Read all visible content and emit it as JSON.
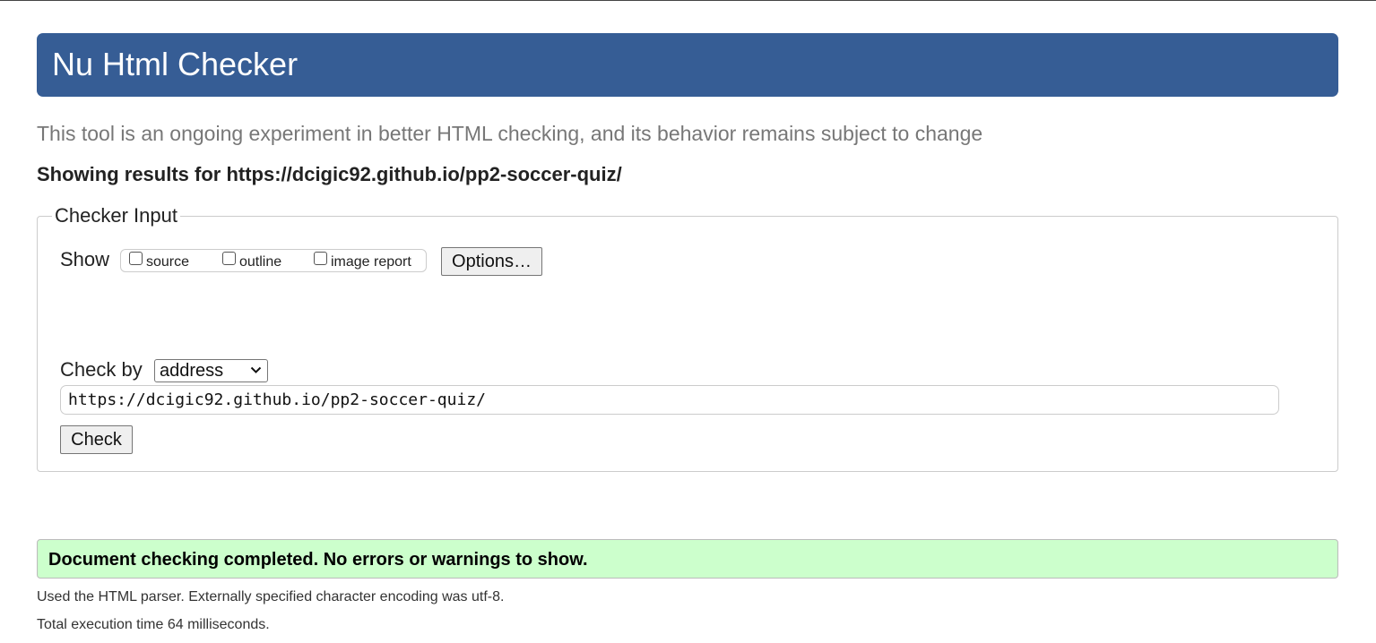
{
  "header": {
    "title": "Nu Html Checker"
  },
  "subtitle": "This tool is an ongoing experiment in better HTML checking, and its behavior remains subject to change",
  "showing_results": "Showing results for https://dcigic92.github.io/pp2-soccer-quiz/",
  "checker_input": {
    "legend": "Checker Input",
    "show_label": "Show",
    "show_options": [
      {
        "label": "source",
        "checked": false
      },
      {
        "label": "outline",
        "checked": false
      },
      {
        "label": "image report",
        "checked": false
      }
    ],
    "options_button": "Options…",
    "check_by_label": "Check by",
    "check_by_selected": "address",
    "url_value": "https://dcigic92.github.io/pp2-soccer-quiz/",
    "check_button": "Check"
  },
  "result": {
    "message": "Document checking completed. No errors or warnings to show.",
    "status_color": "#ccffcc"
  },
  "details": {
    "parser": "Used the HTML parser. Externally specified character encoding was utf-8.",
    "execution_time": "Total execution time 64 milliseconds."
  },
  "colors": {
    "header_bg": "#365d95",
    "success_bg": "#ccffcc"
  },
  "icons": {
    "select_arrow": "chevron-down-icon"
  }
}
